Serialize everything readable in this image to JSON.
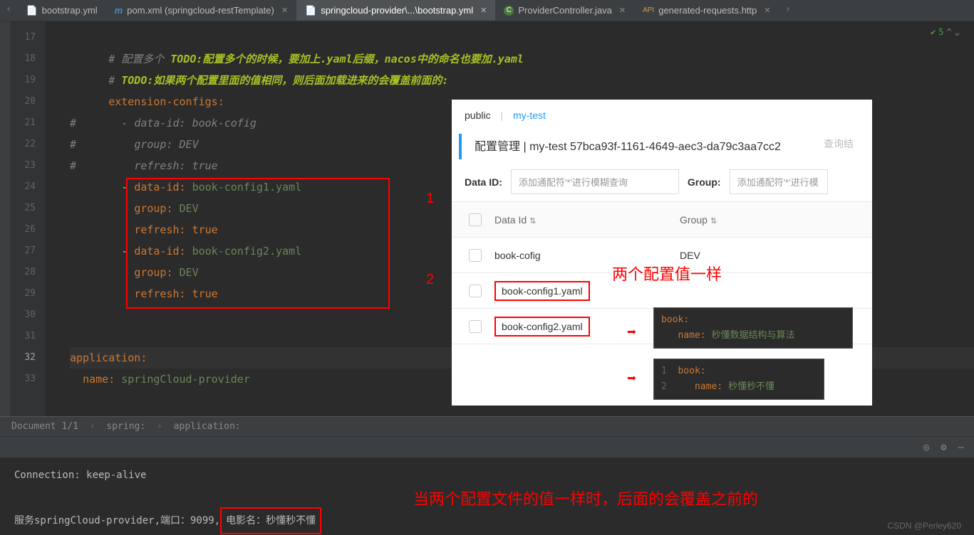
{
  "tabs": [
    {
      "label": "bootstrap.yml",
      "icon": ""
    },
    {
      "label": "pom.xml (springcloud-restTemplate)",
      "icon": "m"
    },
    {
      "label": "springcloud-provider\\...\\bootstrap.yml",
      "icon": "",
      "active": true
    },
    {
      "label": "ProviderController.java",
      "icon": "C"
    },
    {
      "label": "generated-requests.http",
      "icon": ""
    }
  ],
  "status": {
    "count": "5",
    "chevron": "^"
  },
  "gutter": [
    "17",
    "18",
    "19",
    "20",
    "21",
    "22",
    "23",
    "24",
    "25",
    "26",
    "27",
    "28",
    "29",
    "30",
    "31",
    "32",
    "33"
  ],
  "code": {
    "c1p": "# 配置多个 ",
    "c1t": "TODO:配置多个的时候，要加上.yaml后缀，",
    "c1t2": "nacos",
    "c1t3": "中的命名也要加.yaml",
    "c2p": "# ",
    "c2t": "TODO:如果两个配置里面的值相同，则后面加载进来的会覆盖前面的:",
    "k_ext": "extension-configs",
    "h": "#",
    "k_dataid": "data-id",
    "v_bookcofig": "book-cofig",
    "k_group": "group",
    "v_dev": "DEV",
    "k_refresh": "refresh",
    "v_true": "true",
    "v_cfg1": "book-config1.yaml",
    "v_cfg2": "book-config2.yaml",
    "k_app": "application",
    "k_name": "name",
    "v_appname": "springCloud-provider"
  },
  "annotations": {
    "n1": "1",
    "n2": "2",
    "sameValue": "两个配置值一样",
    "bottom": "当两个配置文件的值一样时，后面的会覆盖之前的"
  },
  "panel": {
    "tab1": "public",
    "tab2": "my-test",
    "title": "配置管理",
    "sep": "|",
    "ns": "my-test  57bca93f-1161-4649-aec3-da79c3aa7cc2",
    "queryHint": "查询结",
    "dataIdLabel": "Data ID:",
    "dataIdPh": "添加通配符'*'进行模糊查询",
    "groupLabel": "Group:",
    "groupPh": "添加通配符'*'进行模",
    "colDataId": "Data Id",
    "colGroup": "Group",
    "rows": [
      {
        "id": "book-cofig",
        "group": "DEV"
      },
      {
        "id": "book-config1.yaml",
        "group": ""
      },
      {
        "id": "book-config2.yaml",
        "group": ""
      }
    ]
  },
  "tooltips": {
    "t1": {
      "k1": "book",
      "k2": "name",
      "v": "秒懂数据结构与算法"
    },
    "t2": {
      "k1": "book",
      "k2": "name",
      "v": "秒懂秒不懂",
      "ln1": "1",
      "ln2": "2"
    }
  },
  "breadcrumb": {
    "a": "Document 1/1",
    "b": "spring:",
    "c": "application:"
  },
  "console": {
    "l1": "Connection: keep-alive",
    "l2a": "服务springCloud-provider,端口：9099,",
    "l2b": "电影名：秒懂秒不懂"
  },
  "watermark": "CSDN @Perley620"
}
